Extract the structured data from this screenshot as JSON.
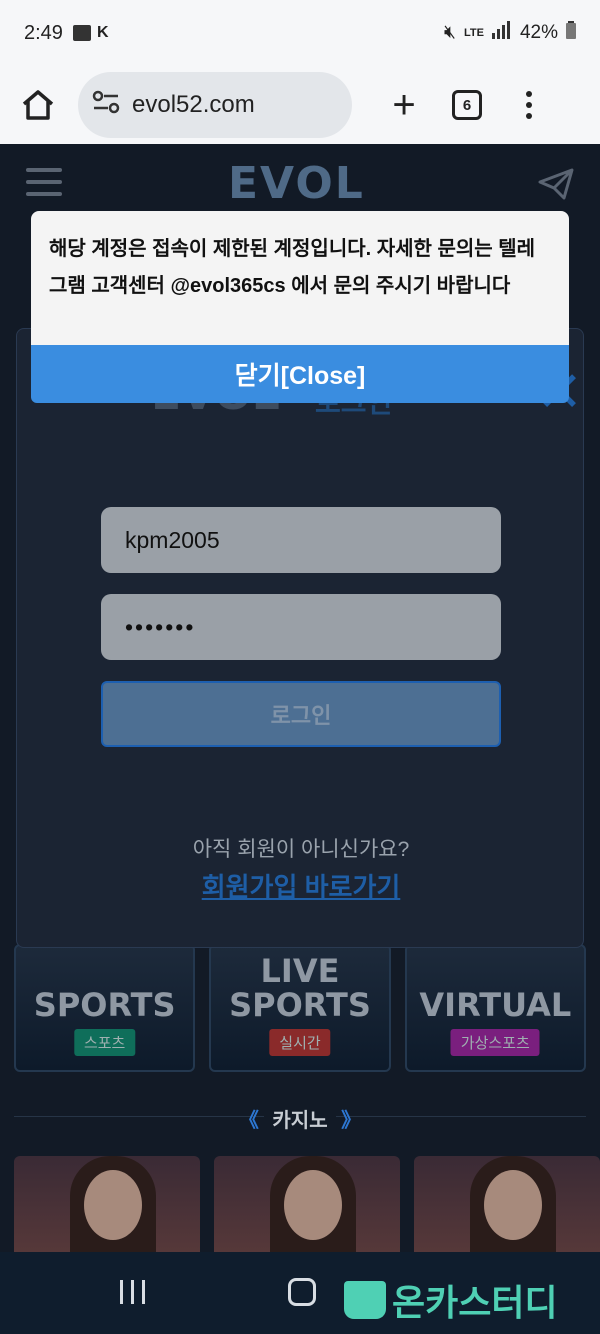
{
  "status_bar": {
    "time": "2:49",
    "battery": "42%",
    "network": "LTE"
  },
  "browser": {
    "url": "evol52.com",
    "tab_count": "6"
  },
  "site": {
    "logo": "EVOL"
  },
  "login": {
    "title": "EVOL",
    "title_sub": "로그인",
    "username_value": "kpm2005",
    "password_value": "•••••••",
    "login_button": "로그인",
    "not_member_text": "아직 회원이 아니신가요?",
    "signup_link": "회원가입 바로가기"
  },
  "alert": {
    "message": "해당 계정은 접속이 제한된 계정입니다. 자세한 문의는 텔레그램 고객센터 @evol365cs 에서 문의 주시기 바랍니다",
    "close_button": "닫기[Close]"
  },
  "categories": [
    {
      "title": "SPORTS",
      "badge": "스포츠",
      "badge_color": "#0f6e5a"
    },
    {
      "title_line1": "LIVE",
      "title_line2": "SPORTS",
      "badge": "실시간",
      "badge_color": "#8a2a2a"
    },
    {
      "title": "VIRTUAL",
      "badge": "가상스포츠",
      "badge_color": "#7a1f7e"
    }
  ],
  "casino_section": {
    "left_mark": "《",
    "label": "카지노",
    "right_mark": "》"
  },
  "watermark": {
    "text": "온카스터디"
  }
}
